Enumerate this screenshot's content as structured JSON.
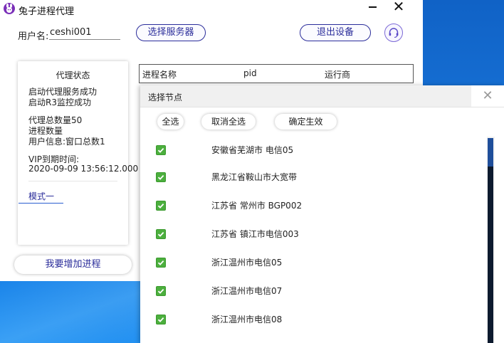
{
  "window": {
    "title": "兔子进程代理",
    "minimize_label": "",
    "close_label": "✕"
  },
  "user": {
    "label": "用户名:",
    "value": "ceshi001"
  },
  "toolbar": {
    "select_server_label": "选择服务器",
    "logout_label": "退出设备"
  },
  "status_card": {
    "title": "代理状态",
    "lines": [
      "启动代理服务成功",
      "启动R3监控成功",
      "代理总数量50",
      "进程数量",
      "用户信息:窗口总数1",
      "VIP到期时间:",
      "2020-09-09 13:56:12.000"
    ],
    "mode_tab": "模式一",
    "add_process_label": "我要增加进程"
  },
  "process_table": {
    "columns": [
      "进程名称",
      "pid",
      "运行商"
    ]
  },
  "dialog": {
    "title": "选择节点",
    "close_label": "✕",
    "buttons": {
      "select_all": "全选",
      "deselect_all": "取消全选",
      "confirm": "确定生效"
    },
    "nodes": [
      {
        "label": "安徽省芜湖市 电信05",
        "checked": true
      },
      {
        "label": "黑龙江省鞍山市大宽带",
        "checked": true
      },
      {
        "label": "江苏省 常州市 BGP002",
        "checked": true
      },
      {
        "label": "江苏省 镇江市电信003",
        "checked": true
      },
      {
        "label": "浙江温州市电信05",
        "checked": true
      },
      {
        "label": "浙江温州市电信07",
        "checked": true
      },
      {
        "label": "浙江温州市电信08",
        "checked": true
      }
    ]
  },
  "colors": {
    "accent": "#2a2c9a",
    "checkbox": "#4caf3e",
    "desktop": "#1a75d2",
    "scrollbar": "#1f4e9a"
  }
}
